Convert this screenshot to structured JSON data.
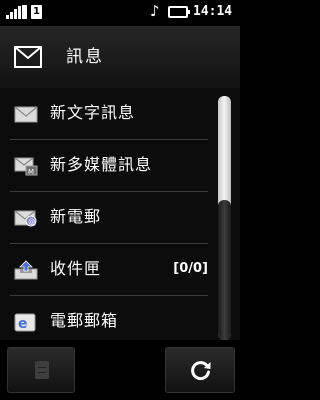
{
  "status_bar": {
    "signal_icon": "signal-strength-icon",
    "sim_badge": "1",
    "music_icon": "music-note-icon",
    "battery_icon": "battery-icon",
    "time": "14:14"
  },
  "header": {
    "icon": "envelope-icon",
    "title": "訊息"
  },
  "menu": {
    "items": [
      {
        "label": "新文字訊息",
        "icon": "envelope-icon",
        "count": ""
      },
      {
        "label": "新多媒體訊息",
        "icon": "multimedia-message-icon",
        "count": ""
      },
      {
        "label": "新電郵",
        "icon": "email-icon",
        "count": ""
      },
      {
        "label": "收件匣",
        "icon": "inbox-icon",
        "count": "[0/0]"
      },
      {
        "label": "電郵郵箱",
        "icon": "mailbox-icon",
        "count": ""
      }
    ]
  },
  "scrollbar": {
    "position_fraction": 0.42,
    "visible_fraction": 0.57
  },
  "bottom_bar": {
    "left_icon": "menu-icon",
    "right_icon": "refresh-icon"
  }
}
